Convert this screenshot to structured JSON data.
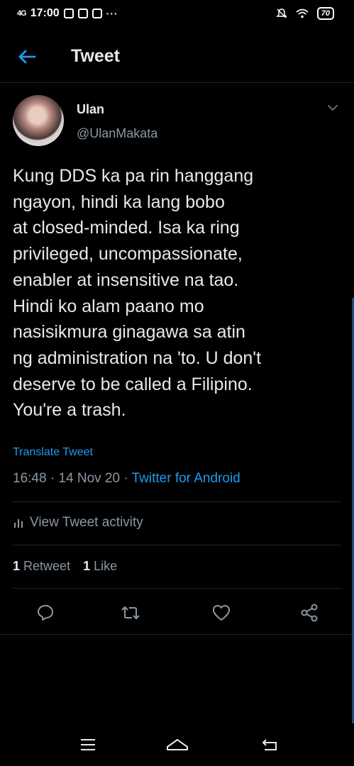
{
  "status_bar": {
    "time": "17:00",
    "signal": "4G",
    "battery": "70"
  },
  "header": {
    "title": "Tweet"
  },
  "tweet": {
    "display_name": "Ulan",
    "handle": "@UlanMakata",
    "text": "Kung DDS ka pa rin hanggang\nngayon, hindi ka lang bobo\nat closed-minded. Isa ka ring\nprivileged, uncompassionate,\nenabler at insensitive na tao.\nHindi ko alam paano mo\nnasisikmura ginagawa sa atin\nng administration na 'to. U don't\ndeserve to be called a Filipino.\nYou're a trash.",
    "translate_label": "Translate Tweet",
    "time": "16:48",
    "date": "14 Nov 20",
    "source": "Twitter for Android",
    "activity_label": "View Tweet activity",
    "retweet_count": "1",
    "retweet_label": "Retweet",
    "like_count": "1",
    "like_label": "Like"
  },
  "colors": {
    "background": "#000000",
    "text": "#e7e9ea",
    "secondary": "#8b98a5",
    "accent": "#1d9bf0"
  },
  "icons": [
    "back-arrow-icon",
    "chevron-down-icon",
    "reply-icon",
    "retweet-icon",
    "like-icon",
    "share-icon",
    "menu-icon",
    "home-icon",
    "back-nav-icon",
    "bar-chart-icon"
  ]
}
